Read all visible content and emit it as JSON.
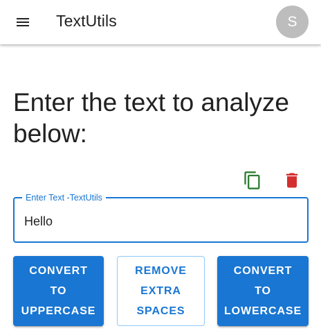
{
  "appbar": {
    "menu_icon": "menu-icon",
    "title": "TextUtils",
    "avatar_initial": "S"
  },
  "main": {
    "heading": "Enter the text to analyze below:",
    "actions": {
      "copy_icon": "copy-icon",
      "delete_icon": "delete-icon"
    },
    "text_field": {
      "label": "Enter Text -TextUtils",
      "value": "Hello"
    },
    "buttons": {
      "uppercase": "Convert to Uppercase",
      "remove_spaces": "Remove Extra Spaces",
      "lowercase": "Convert to Lowercase"
    }
  },
  "colors": {
    "primary": "#1976d2",
    "copy_icon": "#2e7d32",
    "delete_icon": "#d32f2f",
    "avatar_bg": "#bdbdbd"
  }
}
